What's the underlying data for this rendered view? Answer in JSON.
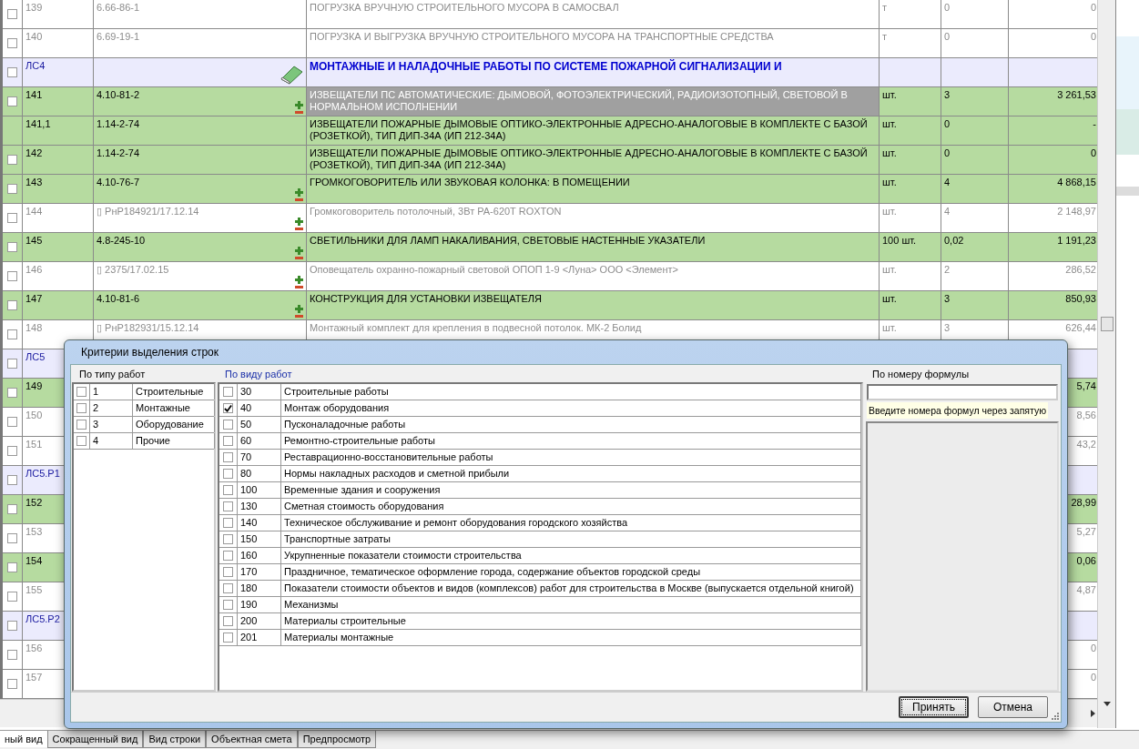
{
  "table": {
    "rows": [
      {
        "kind": "resource",
        "checked": false,
        "num": "139",
        "code": "6.66-86-1",
        "name": "ПОГРУЗКА ВРУЧНУЮ СТРОИТЕЛЬНОГО МУСОРА В САМОСВАЛ",
        "unit": "т",
        "qty": "0",
        "sum": "0",
        "selected": false
      },
      {
        "kind": "resource",
        "checked": false,
        "num": "140",
        "code": "6.69-19-1",
        "name": "ПОГРУЗКА И ВЫГРУЗКА ВРУЧНУЮ СТРОИТЕЛЬНОГО МУСОРА НА ТРАНСПОРТНЫЕ СРЕДСТВА",
        "unit": "т",
        "qty": "0",
        "sum": "0",
        "selected": false
      },
      {
        "kind": "section",
        "checked": false,
        "num": "ЛС4",
        "name": "МОНТАЖНЫЕ И НАЛАДОЧНЫЕ РАБОТЫ ПО СИСТЕМЕ ПОЖАРНОЙ СИГНАЛИЗАЦИИ И",
        "selected": false
      },
      {
        "kind": "item",
        "checked": false,
        "num": "141",
        "code": "4.10-81-2",
        "name": "ИЗВЕЩАТЕЛИ ПС АВТОМАТИЧЕСКИЕ: ДЫМОВОЙ, ФОТОЭЛЕКТРИЧЕСКИЙ, РАДИОИЗОТОПНЫЙ, СВЕТОВОЙ В НОРМАЛЬНОМ ИСПОЛНЕНИИ",
        "unit": "шт.",
        "qty": "3",
        "sum": "3 261,53",
        "toggle": true,
        "selected": true
      },
      {
        "kind": "item",
        "num": "141,1",
        "code": "1.14-2-74",
        "name": "ИЗВЕЩАТЕЛИ ПОЖАРНЫЕ ДЫМОВЫЕ ОПТИКО-ЭЛЕКТРОННЫЕ АДРЕСНО-АНАЛОГОВЫЕ В КОМПЛЕКТЕ С БАЗОЙ (РОЗЕТКОЙ), ТИП ДИП-34А (ИП 212-34А)",
        "unit": "шт.",
        "qty": "0",
        "sum": "-",
        "selected": false
      },
      {
        "kind": "item",
        "checked": false,
        "num": "142",
        "code": "1.14-2-74",
        "name": "ИЗВЕЩАТЕЛИ ПОЖАРНЫЕ ДЫМОВЫЕ ОПТИКО-ЭЛЕКТРОННЫЕ АДРЕСНО-АНАЛОГОВЫЕ В КОМПЛЕКТЕ С БАЗОЙ (РОЗЕТКОЙ), ТИП ДИП-34А (ИП 212-34А)",
        "unit": "шт.",
        "qty": "0",
        "sum": "0",
        "selected": false
      },
      {
        "kind": "item",
        "checked": false,
        "num": "143",
        "code": "4.10-76-7",
        "name": "ГРОМКОГОВОРИТЕЛЬ ИЛИ ЗВУКОВАЯ КОЛОНКА: В ПОМЕЩЕНИИ",
        "unit": "шт.",
        "qty": "4",
        "sum": "4 868,15",
        "toggle": true,
        "selected": false
      },
      {
        "kind": "resource",
        "checked": false,
        "num": "144",
        "code": "▯ РнР184921/17.12.14",
        "name": "Громкоговоритель потолочный, 3Вт PA-620T ROXTON",
        "unit": "шт.",
        "qty": "4",
        "sum": "2 148,97",
        "toggle": true,
        "selected": false
      },
      {
        "kind": "item",
        "checked": false,
        "num": "145",
        "code": "4.8-245-10",
        "name": "СВЕТИЛЬНИКИ ДЛЯ ЛАМП НАКАЛИВАНИЯ, СВЕТОВЫЕ НАСТЕННЫЕ УКАЗАТЕЛИ",
        "unit": "100 шт.",
        "qty": "0,02",
        "sum": "1 191,23",
        "toggle": true,
        "selected": false
      },
      {
        "kind": "resource",
        "checked": false,
        "num": "146",
        "code": "▯ 2375/17.02.15",
        "name": "Оповещатель охранно-пожарный световой ОПОП 1-9 <Луна> ООО <Элемент>",
        "unit": "шт.",
        "qty": "2",
        "sum": "286,52",
        "toggle": true,
        "selected": false
      },
      {
        "kind": "item",
        "checked": false,
        "num": "147",
        "code": "4.10-81-6",
        "name": "КОНСТРУКЦИЯ ДЛЯ УСТАНОВКИ ИЗВЕЩАТЕЛЯ",
        "unit": "шт.",
        "qty": "3",
        "sum": "850,93",
        "toggle": true,
        "selected": false
      },
      {
        "kind": "resource",
        "checked": false,
        "num": "148",
        "code": "▯ РнР182931/15.12.14",
        "name": "Монтажный комплект для крепления в подвесной потолок. МК-2 Болид",
        "unit": "шт.",
        "qty": "3",
        "sum": "626,44",
        "selected": false
      },
      {
        "kind": "section",
        "checked": false,
        "num": "ЛС5"
      },
      {
        "kind": "item",
        "checked": false,
        "num": "149",
        "sum": "5,74"
      },
      {
        "kind": "resource",
        "checked": false,
        "num": "150",
        "sum": "8,56"
      },
      {
        "kind": "resource",
        "checked": false,
        "num": "151",
        "sum": "43,2"
      },
      {
        "kind": "section",
        "checked": false,
        "num": "ЛС5.Р1"
      },
      {
        "kind": "item",
        "checked": false,
        "num": "152",
        "sum": "28,99"
      },
      {
        "kind": "resource",
        "checked": false,
        "num": "153",
        "sum": "5,27"
      },
      {
        "kind": "item",
        "checked": false,
        "num": "154",
        "sum": "0,06"
      },
      {
        "kind": "resource",
        "checked": false,
        "num": "155",
        "sum": "4,87"
      },
      {
        "kind": "section",
        "checked": false,
        "num": "ЛС5.Р2"
      },
      {
        "kind": "resource",
        "checked": false,
        "num": "156",
        "sum": "0"
      },
      {
        "kind": "resource",
        "checked": false,
        "num": "157",
        "sum": "0"
      }
    ]
  },
  "tabs": [
    {
      "label": "ный вид",
      "selected": true
    },
    {
      "label": "Сокращенный вид",
      "selected": false
    },
    {
      "label": "Вид строки",
      "selected": false
    },
    {
      "label": "Объектная смета",
      "selected": false
    },
    {
      "label": "Предпросмотр",
      "selected": false
    }
  ],
  "dialog": {
    "title": "Критерии выделения строк",
    "work_types": {
      "label": "По типу работ",
      "selected": false,
      "items": [
        {
          "code": "1",
          "name": "Строительные",
          "checked": false
        },
        {
          "code": "2",
          "name": "Монтажные",
          "checked": false
        },
        {
          "code": "3",
          "name": "Оборудование",
          "checked": false
        },
        {
          "code": "4",
          "name": "Прочие",
          "checked": false
        }
      ]
    },
    "work_kinds": {
      "label": "По виду работ",
      "selected": true,
      "items": [
        {
          "code": "30",
          "name": "Строительные работы",
          "checked": false
        },
        {
          "code": "40",
          "name": "Монтаж оборудования",
          "checked": true
        },
        {
          "code": "50",
          "name": "Пусконаладочные работы",
          "checked": false
        },
        {
          "code": "60",
          "name": "Ремонтно-строительные работы",
          "checked": false
        },
        {
          "code": "70",
          "name": "Реставрационно-восстановительные работы",
          "checked": false
        },
        {
          "code": "80",
          "name": "Нормы накладных расходов и сметной прибыли",
          "checked": false
        },
        {
          "code": "100",
          "name": "Временные здания и сооружения",
          "checked": false
        },
        {
          "code": "130",
          "name": "Сметная стоимость оборудования",
          "checked": false
        },
        {
          "code": "140",
          "name": "Техническое обслуживание и ремонт оборудования городского хозяйства",
          "checked": false
        },
        {
          "code": "150",
          "name": "Транспортные затраты",
          "checked": false
        },
        {
          "code": "160",
          "name": "Укрупненные показатели стоимости строительства",
          "checked": false
        },
        {
          "code": "170",
          "name": "Праздничное, тематическое оформление города, содержание объектов городской среды",
          "checked": false
        },
        {
          "code": "180",
          "name": "Показатели стоимости объектов и видов (комплексов) работ для строительства в Москве (выпускается отдельной книгой)",
          "checked": false
        },
        {
          "code": "190",
          "name": "Механизмы",
          "checked": false
        },
        {
          "code": "200",
          "name": "Материалы строительные",
          "checked": false
        },
        {
          "code": "201",
          "name": "Материалы монтажные",
          "checked": false
        }
      ]
    },
    "formula": {
      "label": "По номеру формулы",
      "hint": "Введите номера формул через запятую"
    },
    "buttons": [
      {
        "label": "Принять",
        "default": true
      },
      {
        "label": "Отмена",
        "default": false
      }
    ]
  }
}
